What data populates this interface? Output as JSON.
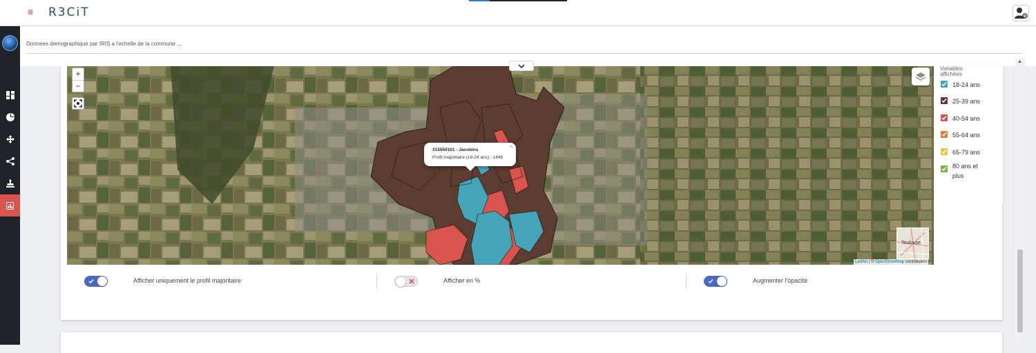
{
  "app": {
    "brand": "R3CiT",
    "menu_icon": "hamburger-icon",
    "user_icon": "user-settings-icon"
  },
  "sidebar": {
    "items": [
      {
        "icon": "dashboard-icon"
      },
      {
        "icon": "pie-chart-icon"
      },
      {
        "icon": "move-arrows-icon"
      },
      {
        "icon": "share-icon"
      },
      {
        "icon": "stamp-icon"
      },
      {
        "icon": "bar-chart-icon",
        "active": true
      }
    ],
    "active_color": "#d9534f"
  },
  "breadcrumb": {
    "text": "Donnees demographique par IRIS a l'echelle de la commune ..."
  },
  "map": {
    "popup": {
      "title": "315550101 - Jacobins",
      "text": "Profil majoritaire (18-24 ans) : 1449",
      "close": "×"
    },
    "minimap_label": "Toulouse",
    "attribution": {
      "leaflet": "Leaflet",
      "separator": " | © ",
      "osm": "OpenStreetMap",
      "suffix": " contributors"
    },
    "zoom_in": "+",
    "zoom_out": "−"
  },
  "legend": {
    "title": "Variables affichées",
    "items": [
      {
        "label": "18-24 ans",
        "color": "#45a5b8"
      },
      {
        "label": "25-39 ans",
        "color": "#5b3c31"
      },
      {
        "label": "40-54 ans",
        "color": "#d9534f"
      },
      {
        "label": "55-64 ans",
        "color": "#e07b39"
      },
      {
        "label": "65-79 ans",
        "color": "#e8c547"
      },
      {
        "label": "80 ans et plus",
        "color": "#7cb342"
      }
    ]
  },
  "toggles": [
    {
      "label": "Afficher uniquement le profil majoritaire",
      "state": "on"
    },
    {
      "label": "Afficher en %",
      "state": "off"
    },
    {
      "label": "Augmenter l'opacité",
      "state": "on"
    }
  ]
}
